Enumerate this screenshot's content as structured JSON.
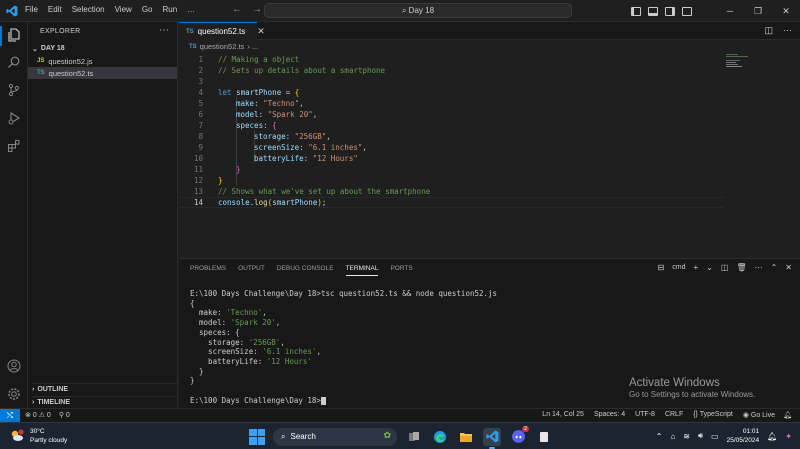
{
  "menu": [
    "File",
    "Edit",
    "Selection",
    "View",
    "Go",
    "Run",
    "…"
  ],
  "command_center": "Day 18",
  "explorer": {
    "title": "EXPLORER",
    "folder": "DAY 18",
    "files": [
      {
        "badge": "JS",
        "name": "question52.js"
      },
      {
        "badge": "TS",
        "name": "question52.ts"
      }
    ],
    "outline": "OUTLINE",
    "timeline": "TIMELINE"
  },
  "editor": {
    "tab_badge": "TS",
    "tab_label": "question52.ts",
    "breadcrumb_badge": "TS",
    "breadcrumb_file": "question52.ts",
    "breadcrumb_rest": "› ...",
    "line_numbers": [
      "1",
      "2",
      "3",
      "4",
      "5",
      "6",
      "7",
      "8",
      "9",
      "10",
      "11",
      "12",
      "13",
      "14"
    ],
    "lines": {
      "l1": "// Making a object",
      "l2": "// Sets up details about a smartphone",
      "l4_kw": "let",
      "l4_var": "smartPhone",
      "l4_rest": " = ",
      "l4_br": "{",
      "l5_key": "make",
      "l5_val": "\"Techno\"",
      "l6_key": "model",
      "l6_val": "\"Spark 20\"",
      "l7_key": "speces",
      "l7_br": "{",
      "l8_key": "storage",
      "l8_val": "\"256GB\"",
      "l9_key": "screenSize",
      "l9_val": "\"6.1 inches\"",
      "l10_key": "batteryLife",
      "l10_val": "\"12 Hours\"",
      "l11_br": "}",
      "l12_br": "}",
      "l13": "// Shows what we've set up about the smartphone",
      "l14_obj": "console",
      "l14_fn": "log",
      "l14_arg": "smartPhone"
    }
  },
  "panel": {
    "tabs": [
      "PROBLEMS",
      "OUTPUT",
      "DEBUG CONSOLE",
      "TERMINAL",
      "PORTS"
    ],
    "shell": "cmd",
    "terminal": {
      "cmd1": "E:\\100 Days Challenge\\Day 18>tsc question52.ts && node question52.js",
      "o_open": "{",
      "make_key": "  make: ",
      "make_val": "'Techno'",
      "model_key": "  model: ",
      "model_val": "'Spark 20'",
      "speces": "  speces: {",
      "storage_key": "    storage: ",
      "storage_val": "'256GB'",
      "screen_key": "    screenSize: ",
      "screen_val": "'6.1 inches'",
      "battery_key": "    batteryLife: ",
      "battery_val": "'12 Hours'",
      "inner_close": "  }",
      "o_close": "}",
      "prompt": "E:\\100 Days Challenge\\Day 18>"
    }
  },
  "watermark": {
    "title": "Activate Windows",
    "subtitle": "Go to Settings to activate Windows."
  },
  "statusbar": {
    "errors": "0",
    "warnings": "0",
    "ports": "0",
    "position": "Ln 14, Col 25",
    "spaces": "Spaces: 4",
    "encoding": "UTF-8",
    "eol": "CRLF",
    "language": "TypeScript",
    "golive": "Go Live"
  },
  "taskbar": {
    "temp": "30°C",
    "weather": "Partly cloudy",
    "search": "Search",
    "time": "01:01",
    "date": "25/05/2024",
    "discord_badge": "2",
    "weather_badge": "1"
  },
  "colors": {
    "accent": "#0078d4",
    "comment": "#6a9955",
    "string": "#ce9178",
    "keyword": "#569cd6"
  }
}
